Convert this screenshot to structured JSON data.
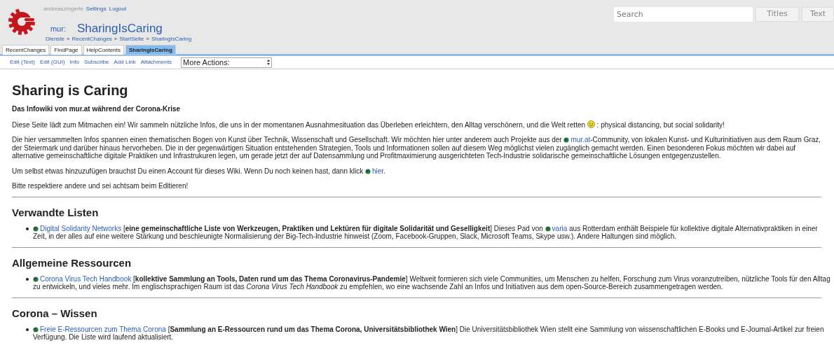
{
  "user_bar": [
    {
      "label": "andreaszingerle",
      "kind": "user"
    },
    {
      "label": "Settings",
      "kind": "link"
    },
    {
      "label": "Logout",
      "kind": "link"
    }
  ],
  "title": {
    "prefix": "mur:",
    "name": "SharingIsCaring"
  },
  "breadcrumbs": [
    {
      "kind": "link",
      "label": "Dienste"
    },
    {
      "kind": "sep",
      "label": "»"
    },
    {
      "kind": "link",
      "label": "RecentChanges"
    },
    {
      "kind": "sep",
      "label": "»"
    },
    {
      "kind": "link",
      "label": "StartSeite"
    },
    {
      "kind": "sep",
      "label": "»"
    },
    {
      "kind": "link",
      "label": "SharingIsCaring"
    }
  ],
  "search": {
    "placeholder": "Search",
    "buttons": [
      "Titles",
      "Text"
    ]
  },
  "tabs": [
    {
      "label": "RecentChanges",
      "selected": false
    },
    {
      "label": "FindPage",
      "selected": false
    },
    {
      "label": "HelpContents",
      "selected": false
    },
    {
      "label": "SharingIsCaring",
      "selected": true
    }
  ],
  "actions": [
    "Edit (Text)",
    "Edit (GUI)",
    "Info",
    "Subscribe",
    "Add Link",
    "Attachments"
  ],
  "more_actions": {
    "label": "More Actions:"
  },
  "page": {
    "heading": "Sharing is Caring",
    "intro": [
      {
        "kind": "bold",
        "segments": [
          {
            "kind": "text",
            "text": "Das Infowiki von mur.at während der Corona-Krise"
          }
        ]
      },
      {
        "kind": "plain",
        "segments": [
          {
            "kind": "text",
            "text": "Diese Seite lädt zum Mitmachen ein! Wir sammeln nützliche Infos, die uns in der momentanen Ausnahmesituation das Überleben erleichtern, den Alltag verschönern, und die Welt retten "
          },
          {
            "kind": "smiley"
          },
          {
            "kind": "text",
            "text": " : physical distancing, but social solidarity!"
          }
        ]
      },
      {
        "kind": "plain",
        "segments": [
          {
            "kind": "text",
            "text": "Die hier versammelten Infos spannen einen thematischen Bogen von Kunst über Technik, Wissenschaft und Gesellschaft. Wir möchten hier unter anderem auch Projekte aus der "
          },
          {
            "kind": "link",
            "text": "mur.at"
          },
          {
            "kind": "text",
            "text": "-Community, von lokalen Kunst- und Kulturinitiativen aus dem Raum Graz, der Steiermark und darüber hinaus hervorheben. Die in der gegenwärtigen Situation entstehenden Strategien, Tools und Informationen sollen auf diesem Weg möglichst vielen zugänglich gemacht werden. Einen besonderen Fokus möchten wir dabei auf alternative gemeinschaftliche digitale Praktiken und Infrastrukuren legen, um gerade jetzt der auf Datensammlung und Profitmaximierung ausgerichteten Tech-Industrie solidarische gemeinschaftliche Lösungen entgegenzustellen."
          }
        ]
      },
      {
        "kind": "plain",
        "segments": [
          {
            "kind": "text",
            "text": "Um selbst etwas hinzuzufügen brauchst Du einen Account für dieses Wiki. Wenn Du noch keinen hast, dann klick "
          },
          {
            "kind": "link",
            "text": "hier"
          },
          {
            "kind": "text",
            "text": "."
          }
        ]
      },
      {
        "kind": "plain",
        "segments": [
          {
            "kind": "text",
            "text": "Bitte respektiere andere und sei achtsam beim Editieren!"
          }
        ]
      }
    ],
    "sections": [
      {
        "heading": "Verwandte Listen",
        "items": [
          [
            {
              "kind": "link",
              "text": "Digital Solidarity Networks"
            },
            {
              "kind": "text",
              "text": " [**eine gemeinschaftliche Liste von Werkzeugen, Praktiken und Lektüren für digitale Solidarität und Geselligkeit**] Dieses Pad von "
            },
            {
              "kind": "link",
              "text": "varia"
            },
            {
              "kind": "text",
              "text": " aus Rotterdam enthält Beispiele für kollektive digitale Alternativpraktiken in einer Zeit, in der alles auf eine weitere Stärkung und beschleunigte Normalisierung der Big-Tech-Industrie hinweist (Zoom, Facebook-Gruppen, Slack, Microsoft Teams, Skype usw.). Andere Haltungen sind möglich."
            }
          ]
        ]
      },
      {
        "heading": "Allgemeine Ressourcen",
        "items": [
          [
            {
              "kind": "link",
              "text": "Corona Virus Tech Handbook"
            },
            {
              "kind": "text",
              "text": " [**kollektive Sammlung an Tools, Daten rund um das Thema Coronavirus-Pandemie**] Weltweit formieren sich viele Communities, um Menschen zu helfen, Forschung zum Virus voranzutreiben, nützliche Tools für den Alltag zu entwickeln, und vieles mehr. Im englischsprachigen Raum ist das *Corona Virus Tech Handbook* zu empfehlen, wo eine wachsende Zahl an Infos und Initiativen aus dem open-Source-Bereich zusammengetragen werden."
            }
          ]
        ]
      },
      {
        "heading": "Corona – Wissen",
        "items": [
          [
            {
              "kind": "link",
              "text": "Freie E-Ressourcen zum Thema Corona"
            },
            {
              "kind": "text",
              "text": " [**Sammlung an E-Ressourcen rund um das Thema Corona, Universitätsbibliothek Wien**] Die Universitätsbibliothek Wien stellt eine Sammlung von wissenschaftlichen E-Books und E-Journal-Artikel zur freien Verfügung. Die Liste wird laufend aktualisiert."
            }
          ]
        ]
      }
    ]
  }
}
